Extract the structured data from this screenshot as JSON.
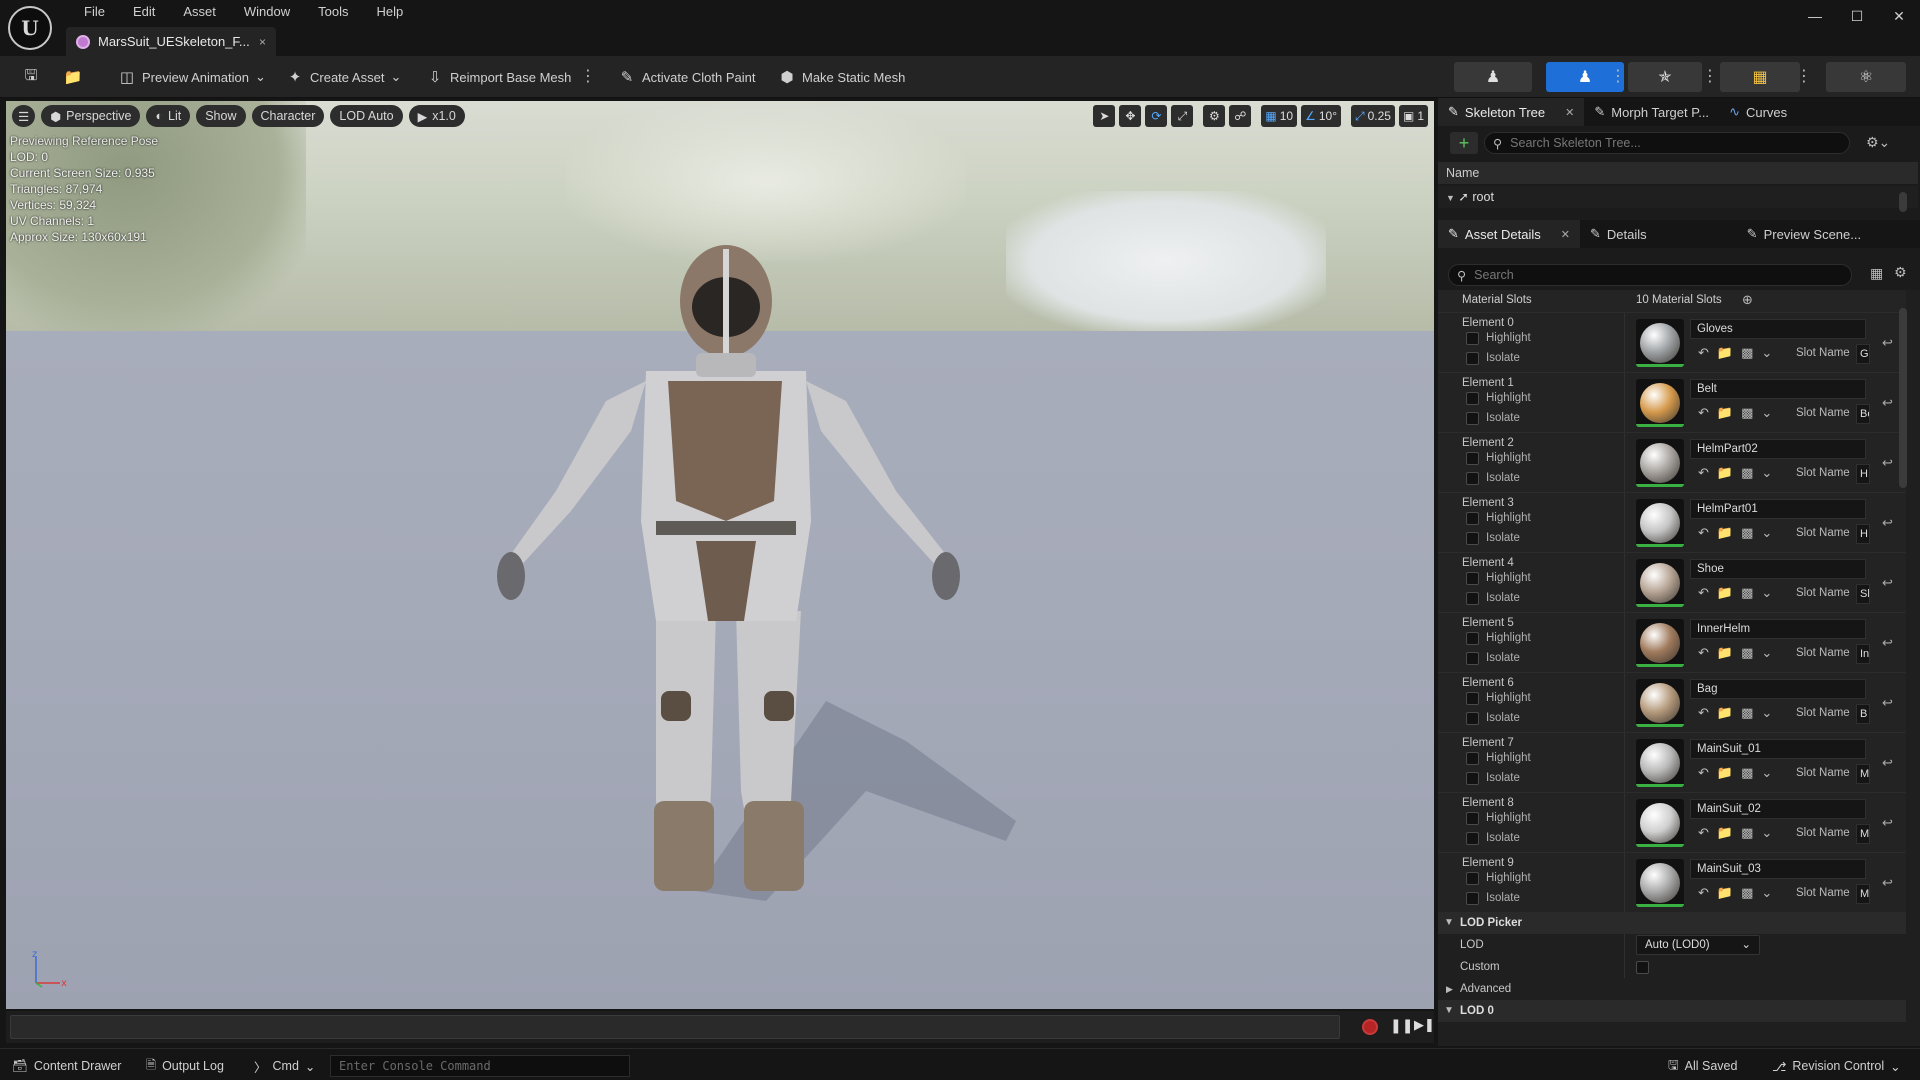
{
  "menu": {
    "items": [
      "File",
      "Edit",
      "Asset",
      "Window",
      "Tools",
      "Help"
    ]
  },
  "document_tab": {
    "title": "MarsSuit_UESkeleton_F...",
    "close": "×"
  },
  "window_controls": {
    "minimize": "—",
    "maximize": "☐",
    "close": "✕"
  },
  "toolbar": {
    "preview_animation": "Preview Animation",
    "create_asset": "Create Asset",
    "reimport_base_mesh": "Reimport Base Mesh",
    "activate_cloth_paint": "Activate Cloth Paint",
    "make_static_mesh": "Make Static Mesh"
  },
  "viewport": {
    "perspective": "Perspective",
    "lit": "Lit",
    "show": "Show",
    "character": "Character",
    "lod_auto": "LOD Auto",
    "play_speed": "x1.0",
    "grid_snap": "10",
    "rot_snap": "10°",
    "scale_snap": "0.25",
    "camera_speed": "1",
    "info": [
      "Previewing Reference Pose",
      "LOD: 0",
      "Current Screen Size: 0.935",
      "Triangles: 87,974",
      "Vertices: 59,324",
      "UV Channels: 1",
      "Approx Size: 130x60x191"
    ]
  },
  "skeleton_panel": {
    "tabs": [
      "Skeleton Tree",
      "Morph Target P...",
      "Curves"
    ],
    "search_placeholder": "Search Skeleton Tree...",
    "column_name": "Name",
    "root": "root"
  },
  "details_panel": {
    "tabs": [
      "Asset Details",
      "Details",
      "Preview Scene..."
    ],
    "search_placeholder": "Search",
    "material_slots_label": "Material Slots",
    "material_slots_count": "10 Material Slots",
    "highlight_label": "Highlight",
    "isolate_label": "Isolate",
    "slot_name_label": "Slot Name",
    "elements": [
      {
        "name": "Element 0",
        "material": "Gloves",
        "slot": "Gl",
        "color": "#9fa3a6"
      },
      {
        "name": "Element 1",
        "material": "Belt",
        "slot": "Be",
        "color": "#d59a4c"
      },
      {
        "name": "Element 2",
        "material": "HelmPart02",
        "slot": "H",
        "color": "#a8a4a0"
      },
      {
        "name": "Element 3",
        "material": "HelmPart01",
        "slot": "H",
        "color": "#c4c4c4"
      },
      {
        "name": "Element 4",
        "material": "Shoe",
        "slot": "Sl",
        "color": "#b7a595"
      },
      {
        "name": "Element 5",
        "material": "InnerHelm",
        "slot": "In",
        "color": "#a07a5c"
      },
      {
        "name": "Element 6",
        "material": "Bag",
        "slot": "B",
        "color": "#b59a7c"
      },
      {
        "name": "Element 7",
        "material": "MainSuit_01",
        "slot": "M",
        "color": "#b8b8b8"
      },
      {
        "name": "Element 8",
        "material": "MainSuit_02",
        "slot": "M",
        "color": "#cfcfcf"
      },
      {
        "name": "Element 9",
        "material": "MainSuit_03",
        "slot": "M",
        "color": "#a9a9a9"
      }
    ],
    "lod_picker": {
      "section": "LOD Picker",
      "lod_label": "LOD",
      "lod_value": "Auto (LOD0)",
      "custom_label": "Custom"
    },
    "advanced": "Advanced",
    "lod0": "LOD 0"
  },
  "statusbar": {
    "content_drawer": "Content Drawer",
    "output_log": "Output Log",
    "cmd": "Cmd",
    "console_placeholder": "Enter Console Command",
    "all_saved": "All Saved",
    "revision_control": "Revision Control"
  }
}
